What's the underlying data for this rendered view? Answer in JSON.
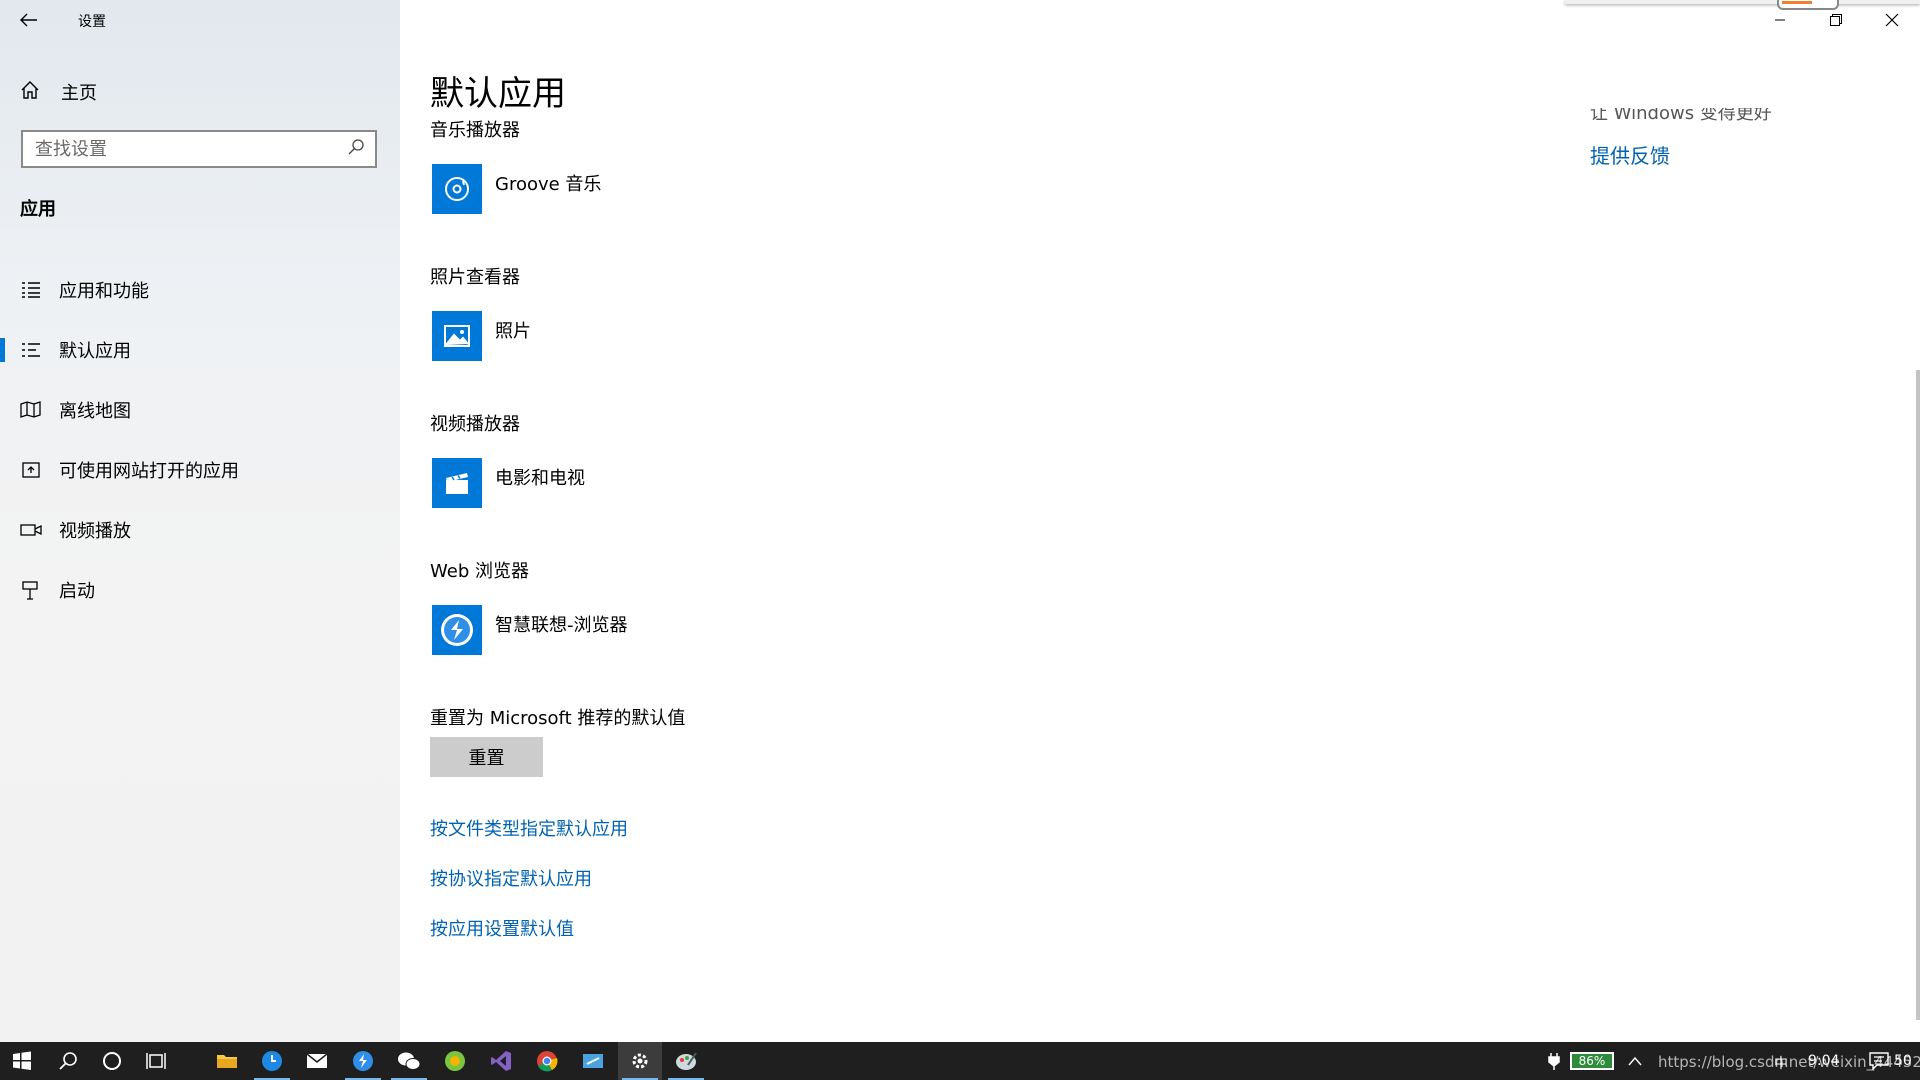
{
  "window": {
    "title": "设置"
  },
  "sidebar": {
    "home_label": "主页",
    "search_placeholder": "查找设置",
    "section_title": "应用",
    "items": [
      {
        "label": "应用和功能",
        "icon": "apps-features-icon"
      },
      {
        "label": "默认应用",
        "icon": "default-apps-icon",
        "active": true
      },
      {
        "label": "离线地图",
        "icon": "offline-maps-icon"
      },
      {
        "label": "可使用网站打开的应用",
        "icon": "apps-for-websites-icon"
      },
      {
        "label": "视频播放",
        "icon": "video-playback-icon"
      },
      {
        "label": "启动",
        "icon": "startup-icon"
      }
    ]
  },
  "main": {
    "title": "默认应用",
    "categories": [
      {
        "label": "音乐播放器",
        "app": "Groove 音乐",
        "icon": "groove-music-icon"
      },
      {
        "label": "照片查看器",
        "app": "照片",
        "icon": "photos-icon"
      },
      {
        "label": "视频播放器",
        "app": "电影和电视",
        "icon": "movies-tv-icon"
      },
      {
        "label": "Web 浏览器",
        "app": "智慧联想-浏览器",
        "icon": "lenovo-browser-icon"
      }
    ],
    "reset_label": "重置为 Microsoft 推荐的默认值",
    "reset_button": "重置",
    "links": [
      "按文件类型指定默认应用",
      "按协议指定默认应用",
      "按应用设置默认值"
    ],
    "side_note": "让 Windows 变得更好",
    "feedback_link": "提供反馈"
  },
  "taskbar": {
    "battery": "86%",
    "ime": "中",
    "time": "9:04",
    "watermark": "https://blog.csdn.net/weixin_44452",
    "notification_count": "50"
  },
  "colors": {
    "accent": "#0078d7",
    "link": "#0063b1",
    "taskbar": "#1f1f1f"
  }
}
